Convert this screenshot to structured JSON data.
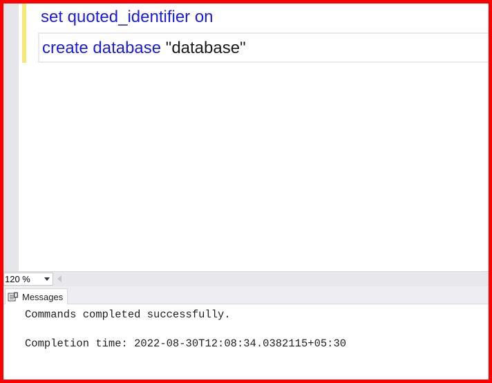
{
  "editor": {
    "lines": [
      {
        "keywords": "set quoted_identifier on",
        "rest": ""
      },
      {
        "keywords": "create database ",
        "rest": "\"database\""
      }
    ]
  },
  "zoom": {
    "value": "120 %"
  },
  "results": {
    "tab_label": "Messages",
    "messages": [
      "Commands completed successfully.",
      "Completion time: 2022-08-30T12:08:34.0382115+05:30"
    ]
  },
  "colors": {
    "keyword": "#1a1ae6",
    "string": "#1a1a1a",
    "frame_border": "#ff0000",
    "change_marker": "#f7e87a"
  },
  "icons": {
    "messages_tab": "messages-icon",
    "zoom_dropdown": "chevron-down-icon",
    "scroll_left": "scroll-left-arrow-icon"
  }
}
